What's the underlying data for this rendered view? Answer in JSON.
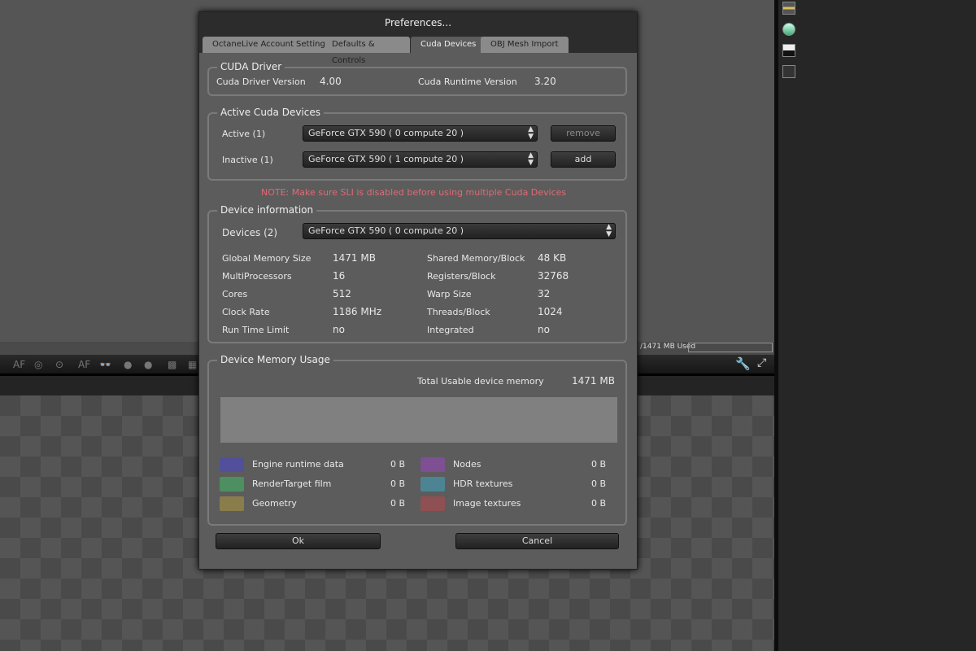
{
  "background": {
    "memory_used": "/1471 MB Used",
    "toolbar_icons": [
      "af-icon",
      "focus-icon",
      "pick-icon",
      "af-text-icon",
      "stereo-glasses-icon",
      "sphere-icon",
      "sphere-alt-icon",
      "pattern-icon",
      "checker-icon"
    ],
    "right_icons": [
      "layer-icon",
      "cylinder-icon",
      "histogram-icon",
      "node-icon"
    ]
  },
  "dialog": {
    "title": "Preferences...",
    "tabs": [
      {
        "label": "OctaneLive Account Settings",
        "active": false
      },
      {
        "label": "Defaults & Controls",
        "active": false
      },
      {
        "label": "Cuda Devices",
        "active": true
      },
      {
        "label": "OBJ Mesh Import",
        "active": false
      }
    ],
    "cuda_driver": {
      "title": "CUDA Driver",
      "driver_label": "Cuda Driver Version",
      "driver_value": "4.00",
      "runtime_label": "Cuda Runtime Version",
      "runtime_value": "3.20"
    },
    "active_devices": {
      "title": "Active Cuda Devices",
      "active_label": "Active (1)",
      "active_value": "GeForce GTX 590 ( 0 compute 20 )",
      "remove_label": "remove",
      "inactive_label": "Inactive (1)",
      "inactive_value": "GeForce GTX 590 ( 1 compute 20 )",
      "add_label": "add"
    },
    "note": "NOTE: Make sure SLI is disabled before using multiple Cuda Devices",
    "device_info": {
      "title": "Device information",
      "devices_label": "Devices (2)",
      "devices_value": "GeForce GTX 590 ( 0 compute 20 )",
      "left": [
        {
          "label": "Global Memory Size",
          "value": "1471 MB"
        },
        {
          "label": "MultiProcessors",
          "value": "16"
        },
        {
          "label": "Cores",
          "value": "512"
        },
        {
          "label": "Clock Rate",
          "value": "1186 MHz"
        },
        {
          "label": "Run Time Limit",
          "value": "no"
        }
      ],
      "right": [
        {
          "label": "Shared Memory/Block",
          "value": "48 KB"
        },
        {
          "label": "Registers/Block",
          "value": "32768"
        },
        {
          "label": "Warp Size",
          "value": "32"
        },
        {
          "label": "Threads/Block",
          "value": "1024"
        },
        {
          "label": "Integrated",
          "value": "no"
        }
      ]
    },
    "memory": {
      "title": "Device Memory Usage",
      "total_label": "Total Usable device memory",
      "total_value": "1471 MB",
      "legend": [
        {
          "label": "Engine runtime data",
          "value": "0 B",
          "color": "#52509a"
        },
        {
          "label": "Nodes",
          "value": "0 B",
          "color": "#7e4f92"
        },
        {
          "label": "RenderTarget film",
          "value": "0 B",
          "color": "#4e8f62"
        },
        {
          "label": "HDR textures",
          "value": "0 B",
          "color": "#4d8493"
        },
        {
          "label": "Geometry",
          "value": "0 B",
          "color": "#8a7d4c"
        },
        {
          "label": "Image textures",
          "value": "0 B",
          "color": "#8e5052"
        }
      ]
    },
    "ok_label": "Ok",
    "cancel_label": "Cancel"
  }
}
